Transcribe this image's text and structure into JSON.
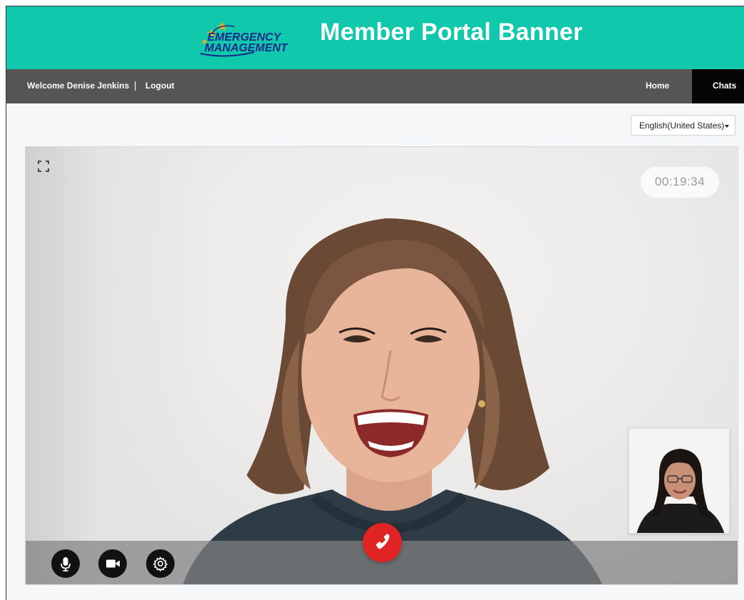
{
  "banner": {
    "logo_line1": "EMERGENCY",
    "logo_line2": "MANAGEMENT",
    "title": "Member Portal Banner",
    "color": "#10c9ac"
  },
  "nav": {
    "welcome": "Welcome Denise Jenkins",
    "separator": "|",
    "logout": "Logout",
    "home": "Home",
    "chats": "Chats"
  },
  "language_select": {
    "selected": "English(United States)"
  },
  "call": {
    "timer": "00:19:34",
    "end_call_color": "#e02323",
    "icons": {
      "expand": "expand-icon",
      "mic": "microphone-icon",
      "camera": "video-camera-icon",
      "settings": "gear-icon",
      "end": "phone-hangup-icon"
    }
  }
}
